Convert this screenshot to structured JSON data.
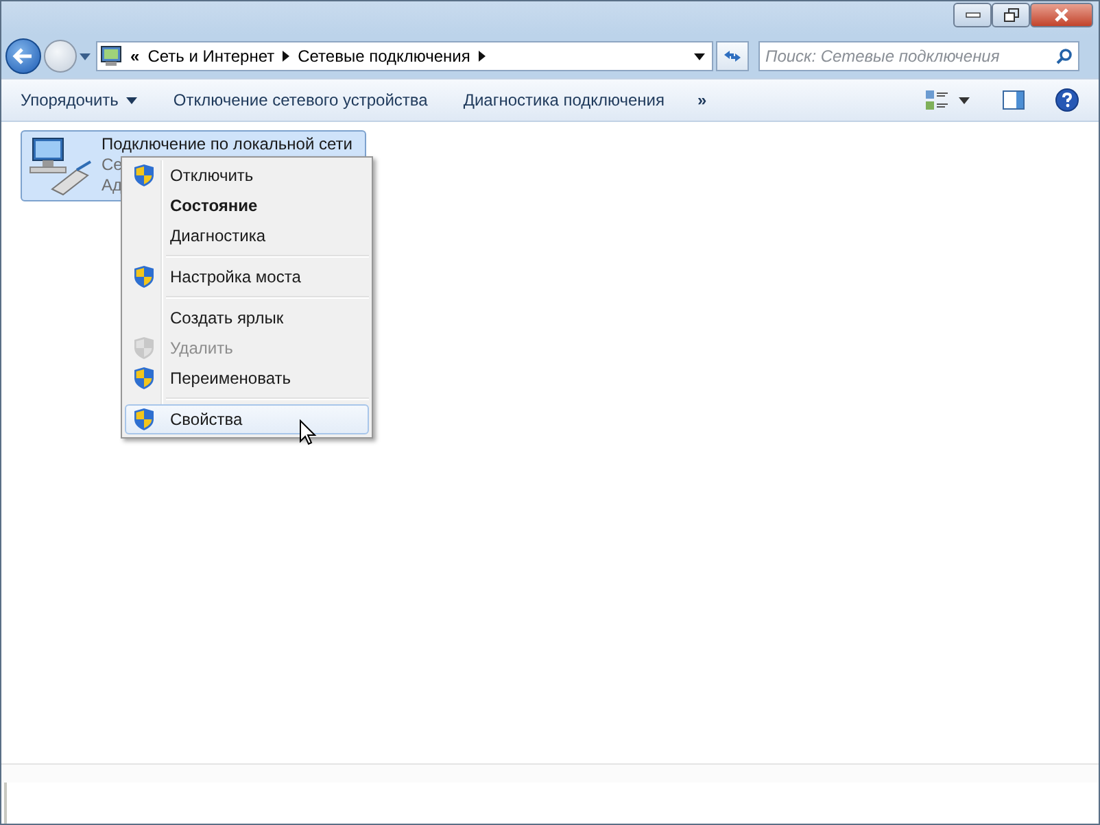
{
  "address": {
    "overflow": "«",
    "crumbs": [
      "Сеть и Интернет",
      "Сетевые подключения"
    ]
  },
  "search": {
    "placeholder": "Поиск: Сетевые подключения"
  },
  "toolbar": {
    "buttons": [
      {
        "label": "Упорядочить",
        "dropdown": true
      },
      {
        "label": "Отключение сетевого устройства",
        "dropdown": false
      },
      {
        "label": "Диагностика подключения",
        "dropdown": false
      }
    ],
    "more": "»"
  },
  "item": {
    "name": "Подключение по локальной сети",
    "line_2": "Се",
    "line_3": "Ад",
    "selected": true
  },
  "context_menu": [
    {
      "kind": "item",
      "label": "Отключить",
      "shield": true,
      "default": false,
      "disabled": false,
      "selected": false
    },
    {
      "kind": "item",
      "label": "Состояние",
      "shield": false,
      "default": true,
      "disabled": false,
      "selected": false
    },
    {
      "kind": "item",
      "label": "Диагностика",
      "shield": false,
      "default": false,
      "disabled": false,
      "selected": false
    },
    {
      "kind": "separator"
    },
    {
      "kind": "item",
      "label": "Настройка моста",
      "shield": true,
      "default": false,
      "disabled": false,
      "selected": false
    },
    {
      "kind": "separator"
    },
    {
      "kind": "item",
      "label": "Создать ярлык",
      "shield": false,
      "default": false,
      "disabled": false,
      "selected": false
    },
    {
      "kind": "item",
      "label": "Удалить",
      "shield": true,
      "default": false,
      "disabled": true,
      "selected": false
    },
    {
      "kind": "item",
      "label": "Переименовать",
      "shield": true,
      "default": false,
      "disabled": false,
      "selected": false
    },
    {
      "kind": "separator"
    },
    {
      "kind": "item",
      "label": "Свойства",
      "shield": true,
      "default": false,
      "disabled": false,
      "selected": true
    }
  ]
}
